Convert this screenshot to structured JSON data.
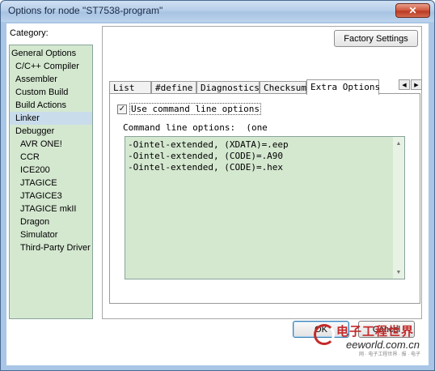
{
  "window": {
    "title": "Options for node \"ST7538-program\"",
    "close_glyph": "✕"
  },
  "category": {
    "label": "Category:",
    "items": [
      {
        "label": "General Options",
        "level": 0
      },
      {
        "label": "C/C++ Compiler",
        "level": 1
      },
      {
        "label": "Assembler",
        "level": 1
      },
      {
        "label": "Custom Build",
        "level": 1
      },
      {
        "label": "Build Actions",
        "level": 1
      },
      {
        "label": "Linker",
        "level": 1,
        "selected": true
      },
      {
        "label": "Debugger",
        "level": 1
      },
      {
        "label": "AVR ONE!",
        "level": 2
      },
      {
        "label": "CCR",
        "level": 2
      },
      {
        "label": "ICE200",
        "level": 2
      },
      {
        "label": "JTAGICE",
        "level": 2
      },
      {
        "label": "JTAGICE3",
        "level": 2
      },
      {
        "label": "JTAGICE mkII",
        "level": 2
      },
      {
        "label": "Dragon",
        "level": 2
      },
      {
        "label": "Simulator",
        "level": 2
      },
      {
        "label": "Third-Party Driver",
        "level": 2
      }
    ]
  },
  "factory_settings_label": "Factory Settings",
  "tabs": [
    {
      "label": "List"
    },
    {
      "label": "#define"
    },
    {
      "label": "Diagnostics"
    },
    {
      "label": "Checksum"
    },
    {
      "label": "Extra Options",
      "active": true
    }
  ],
  "tab_scroll": {
    "left_glyph": "◀",
    "right_glyph": "▶"
  },
  "extra_options": {
    "use_command_line_label": "Use command line options",
    "use_command_line_checked": true,
    "check_glyph": "✓",
    "command_line_label": "Command line options:  (one",
    "lines": [
      "-Ointel-extended, (XDATA)=.eep",
      "-Ointel-extended, (CODE)=.A90",
      "-Ointel-extended, (CODE)=.hex"
    ],
    "scroll_up_glyph": "▲",
    "scroll_down_glyph": "▼"
  },
  "buttons": {
    "ok": "OK",
    "cancel": "Cancel"
  },
  "watermark": {
    "cn": "电子工程世界",
    "en": "eeworld.com.cn",
    "sub": "网 · 电子工程世界 · 报 · 电子"
  },
  "colors": {
    "list_bg": "#d4e8d0",
    "window_frame": "#a9c6e6",
    "watermark_red": "#c32a2a"
  }
}
